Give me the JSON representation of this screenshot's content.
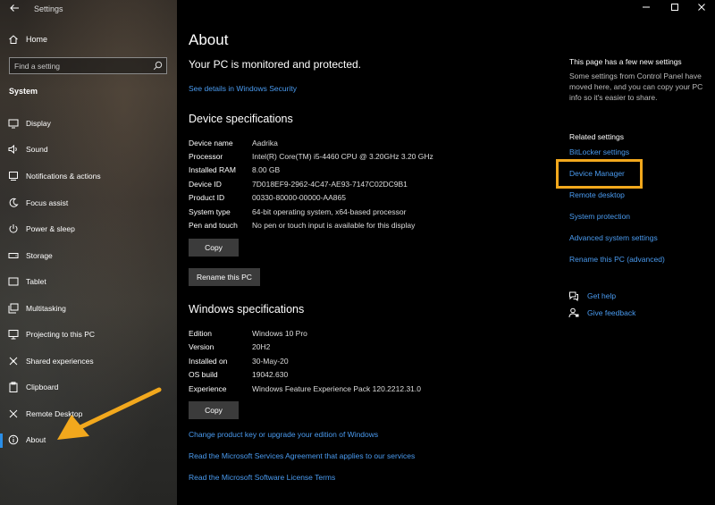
{
  "window": {
    "app_title": "Settings"
  },
  "sidebar": {
    "home_label": "Home",
    "search_placeholder": "Find a setting",
    "section_label": "System",
    "items": [
      {
        "label": "Display",
        "icon": "display-icon"
      },
      {
        "label": "Sound",
        "icon": "sound-icon"
      },
      {
        "label": "Notifications & actions",
        "icon": "notifications-icon"
      },
      {
        "label": "Focus assist",
        "icon": "focus-assist-icon"
      },
      {
        "label": "Power & sleep",
        "icon": "power-icon"
      },
      {
        "label": "Storage",
        "icon": "storage-icon"
      },
      {
        "label": "Tablet",
        "icon": "tablet-icon"
      },
      {
        "label": "Multitasking",
        "icon": "multitasking-icon"
      },
      {
        "label": "Projecting to this PC",
        "icon": "projecting-icon"
      },
      {
        "label": "Shared experiences",
        "icon": "shared-experiences-icon"
      },
      {
        "label": "Clipboard",
        "icon": "clipboard-icon"
      },
      {
        "label": "Remote Desktop",
        "icon": "remote-desktop-icon"
      },
      {
        "label": "About",
        "icon": "info-icon",
        "selected": true
      }
    ]
  },
  "main": {
    "title": "About",
    "protected_text": "Your PC is monitored and protected.",
    "security_link": "See details in Windows Security",
    "device_specs": {
      "heading": "Device specifications",
      "rows": [
        {
          "key": "Device name",
          "value": "Aadrika"
        },
        {
          "key": "Processor",
          "value": "Intel(R) Core(TM) i5-4460  CPU @ 3.20GHz   3.20 GHz"
        },
        {
          "key": "Installed RAM",
          "value": "8.00 GB"
        },
        {
          "key": "Device ID",
          "value": "7D018EF9-2962-4C47-AE93-7147C02DC9B1"
        },
        {
          "key": "Product ID",
          "value": "00330-80000-00000-AA865"
        },
        {
          "key": "System type",
          "value": "64-bit operating system, x64-based processor"
        },
        {
          "key": "Pen and touch",
          "value": "No pen or touch input is available for this display"
        }
      ],
      "copy_label": "Copy",
      "rename_label": "Rename this PC"
    },
    "windows_specs": {
      "heading": "Windows specifications",
      "rows": [
        {
          "key": "Edition",
          "value": "Windows 10 Pro"
        },
        {
          "key": "Version",
          "value": "20H2"
        },
        {
          "key": "Installed on",
          "value": "30-May-20"
        },
        {
          "key": "OS build",
          "value": "19042.630"
        },
        {
          "key": "Experience",
          "value": "Windows Feature Experience Pack 120.2212.31.0"
        }
      ],
      "copy_label": "Copy"
    },
    "links": [
      "Change product key or upgrade your edition of Windows",
      "Read the Microsoft Services Agreement that applies to our services",
      "Read the Microsoft Software License Terms"
    ]
  },
  "right": {
    "note_title": "This page has a few new settings",
    "note_text": "Some settings from Control Panel have moved here, and you can copy your PC info so it's easier to share.",
    "related_title": "Related settings",
    "related_links": [
      "BitLocker settings",
      "Device Manager",
      "Remote desktop",
      "System protection",
      "Advanced system settings",
      "Rename this PC (advanced)"
    ],
    "get_help": "Get help",
    "give_feedback": "Give feedback"
  },
  "colors": {
    "accent_link": "#4a9bf0",
    "highlight": "#f2a81d",
    "arrow": "#f2a81d"
  }
}
